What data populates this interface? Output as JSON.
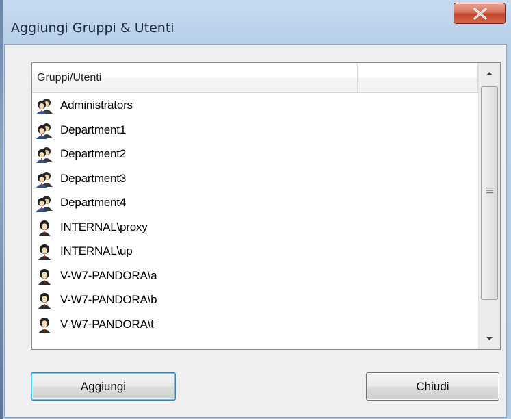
{
  "window": {
    "title": "Aggiungi Gruppi & Utenti",
    "close_glyph": "X"
  },
  "list": {
    "columns": [
      "Gruppi/Utenti",
      ""
    ],
    "items": [
      {
        "label": "Administrators",
        "icon": "group-icon"
      },
      {
        "label": "Department1",
        "icon": "group-icon"
      },
      {
        "label": "Department2",
        "icon": "group-icon"
      },
      {
        "label": "Department3",
        "icon": "group-icon"
      },
      {
        "label": "Department4",
        "icon": "group-icon"
      },
      {
        "label": "INTERNAL\\proxy",
        "icon": "user-icon"
      },
      {
        "label": "INTERNAL\\up",
        "icon": "user-icon"
      },
      {
        "label": "V-W7-PANDORA\\a",
        "icon": "user-icon"
      },
      {
        "label": "V-W7-PANDORA\\b",
        "icon": "user-icon"
      },
      {
        "label": "V-W7-PANDORA\\t",
        "icon": "user-icon"
      }
    ]
  },
  "buttons": {
    "add_label": "Aggiungi",
    "close_label": "Chiudi"
  },
  "colors": {
    "close_button": "#c7462c",
    "window_frame": "#b9d0ea",
    "focus_border": "#3c7fb1"
  }
}
